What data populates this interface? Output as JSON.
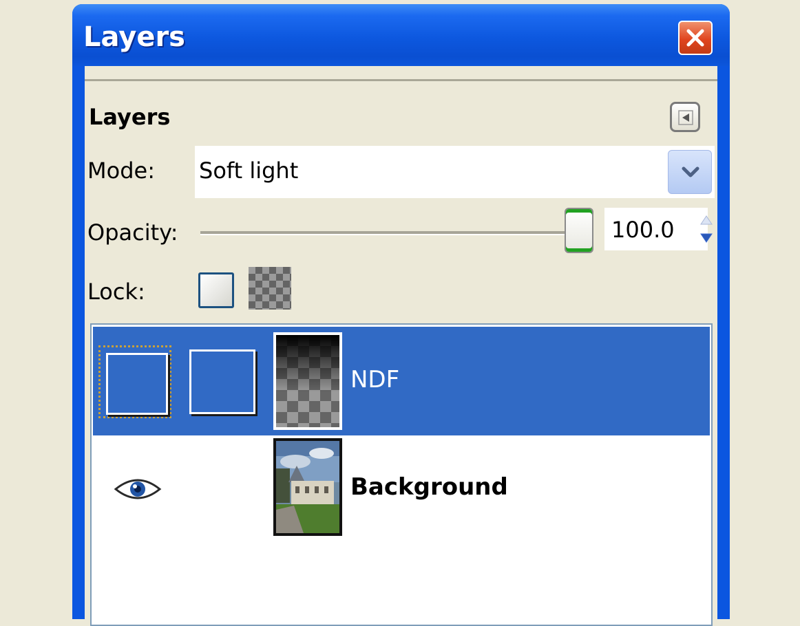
{
  "window": {
    "title": "Layers",
    "close_icon": "close-icon"
  },
  "panel": {
    "title": "Layers",
    "menu_icon": "triangle-left-icon"
  },
  "mode": {
    "label": "Mode:",
    "value": "Soft light",
    "dropdown_icon": "chevron-down-icon"
  },
  "opacity": {
    "label": "Opacity:",
    "value": "100.0",
    "level": 100
  },
  "lock": {
    "label": "Lock:",
    "pixels_icon": "lock-pixels-icon",
    "alpha_icon": "lock-alpha-checker-icon"
  },
  "layers": [
    {
      "name": "NDF",
      "selected": true,
      "visible": false,
      "bold": false
    },
    {
      "name": "Background",
      "selected": false,
      "visible": true,
      "bold": true
    }
  ],
  "colors": {
    "titlebar": "#0b56e0",
    "selection": "#316ac5",
    "close_button": "#e0451f",
    "slider_accent": "#21a121"
  }
}
